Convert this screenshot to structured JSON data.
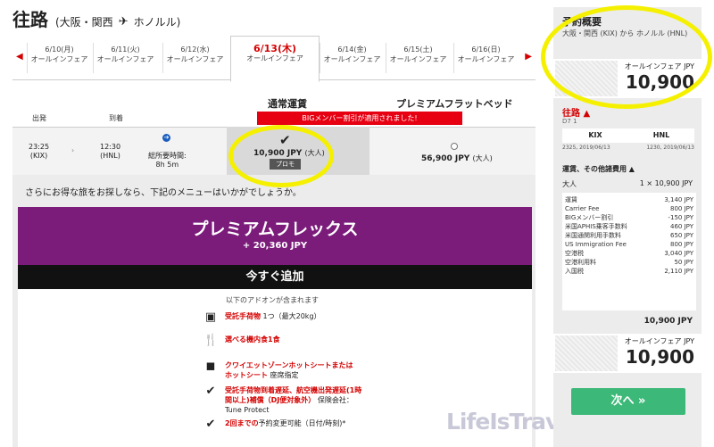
{
  "header": {
    "title": "往路",
    "origin": "(大阪・関西",
    "destination": "ホノルル)"
  },
  "dates": [
    {
      "date": "6/10(月)",
      "label": "オールインフェア"
    },
    {
      "date": "6/11(火)",
      "label": "オールインフェア"
    },
    {
      "date": "6/12(水)",
      "label": "オールインフェア"
    },
    {
      "date": "6/13(木)",
      "label": "オールインフェア"
    },
    {
      "date": "6/14(金)",
      "label": "オールインフェア"
    },
    {
      "date": "6/15(土)",
      "label": "オールインフェア"
    },
    {
      "date": "6/16(日)",
      "label": "オールインフェア"
    }
  ],
  "fare_headers": {
    "standard": "通常運賃",
    "premium": "プレミアムフラットベッド",
    "depart": "出発",
    "arrive": "到着",
    "banner": "BIGメンバー割引が適用されました!"
  },
  "flight": {
    "dep_time": "23:25",
    "dep_code": "(KIX)",
    "arr_time": "12:30",
    "arr_code": "(HNL)",
    "duration_label": "総所要時間:",
    "duration": "8h 5m",
    "price_standard": "10,900 JPY",
    "price_other": "56,900 JPY",
    "adult": "(大人)",
    "promo": "プロモ"
  },
  "addon": {
    "intro": "さらにお得な旅をお探しなら、下記のメニューはいかがでしょうか。",
    "title": "プレミアムフレックス",
    "price": "+ 20,360 JPY",
    "add_button": "今すぐ追加",
    "included": "以下のアドオンが含まれます",
    "features": [
      {
        "icon": "luggage-icon",
        "red": "受託手荷物",
        "text": " 1つ（最大20kg）"
      },
      {
        "icon": "meal-icon",
        "red": "選べる機内食1食",
        "text": ""
      },
      {
        "icon": "seat-icon",
        "red": "クワイエットゾーンホットシートまたはホットシート",
        "text": " 座席指定"
      },
      {
        "icon": "check-icon",
        "red": "受託手荷物到着遅延、航空機出発遅延(1時間以上)補償（DJ便対象外）",
        "text": " 保険会社：Tune Protect"
      },
      {
        "icon": "check-icon",
        "red": "2回までの",
        "text": "予約変更可能（日付/時刻)*"
      }
    ]
  },
  "watermark": "LifeIsTravelS.com",
  "sidebar": {
    "title": "予約概要",
    "route": "大阪・関西 (KIX) から ホノルル (HNL)",
    "fare_label": "オールインフェア JPY",
    "price": "10,900",
    "outbound": "往路",
    "flight_no": "D7 1",
    "from": "KIX",
    "to": "HNL",
    "dep": "2325, 2019/06/13",
    "arr": "1230, 2019/06/13",
    "fees_header": "運賃、その他諸費用",
    "adult_label": "大人",
    "adult_value": "1 × 10,900 JPY",
    "fees": [
      {
        "name": "運賃",
        "value": "3,140 JPY"
      },
      {
        "name": "Carrier Fee",
        "value": "800 JPY"
      },
      {
        "name": "BIGメンバー割引",
        "value": "-150 JPY"
      },
      {
        "name": "米国APHIS乗客手数料",
        "value": "460 JPY"
      },
      {
        "name": "米国通関利用手数料",
        "value": "650 JPY"
      },
      {
        "name": "US Immigration Fee",
        "value": "800 JPY"
      },
      {
        "name": "空港税",
        "value": "3,040 JPY"
      },
      {
        "name": "空港利用料",
        "value": "50 JPY"
      },
      {
        "name": "入国税",
        "value": "2,110 JPY"
      }
    ],
    "total": "10,900 JPY",
    "next_button": "次へ »"
  }
}
